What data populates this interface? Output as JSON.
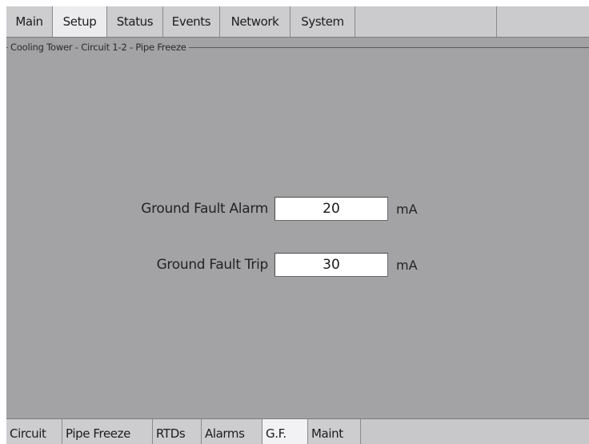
{
  "top_tabs": [
    {
      "label": "Main",
      "active": false
    },
    {
      "label": "Setup",
      "active": true
    },
    {
      "label": "Status",
      "active": false
    },
    {
      "label": "Events",
      "active": false
    },
    {
      "label": "Network",
      "active": false
    },
    {
      "label": "System",
      "active": false
    }
  ],
  "group": {
    "title": "Cooling Tower - Circuit 1-2 - Pipe Freeze"
  },
  "settings": {
    "gf_alarm": {
      "label": "Ground Fault Alarm",
      "value": "20",
      "unit": "mA"
    },
    "gf_trip": {
      "label": "Ground Fault Trip",
      "value": "30",
      "unit": "mA"
    }
  },
  "bottom_tabs": [
    {
      "label": "Circuit",
      "active": false
    },
    {
      "label": "Pipe Freeze",
      "active": false
    },
    {
      "label": "RTDs",
      "active": false
    },
    {
      "label": "Alarms",
      "active": false
    },
    {
      "label": "G.F.",
      "active": true
    },
    {
      "label": "Maint",
      "active": false
    }
  ],
  "colors": {
    "panel_background": "#a3a3a5",
    "tab_background": "#cdcdcf",
    "active_tab_background": "#ececee",
    "input_background": "#ffffff"
  }
}
